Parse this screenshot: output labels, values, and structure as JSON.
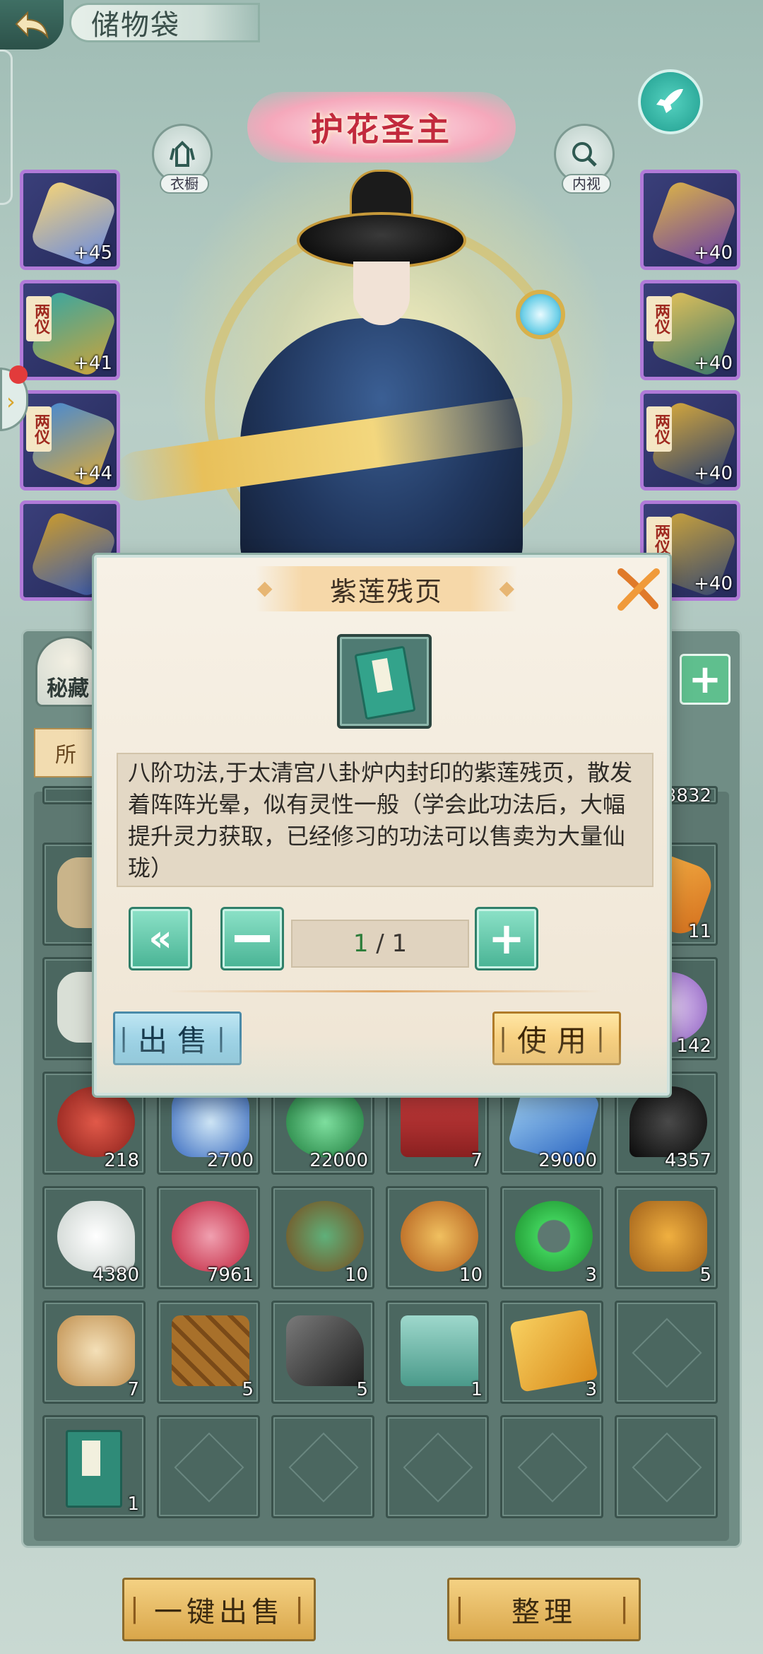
{
  "header": {
    "title": "储物袋",
    "back_icon": "back-arrow-icon"
  },
  "stage": {
    "title_banner": "护花圣主",
    "btn_outfit": "衣橱",
    "btn_inspect": "内视"
  },
  "left_slots": [
    {
      "level": "+45",
      "tag": ""
    },
    {
      "level": "+41",
      "tag": "两仪"
    },
    {
      "level": "+44",
      "tag": "两仪"
    },
    {
      "level": "",
      "tag": ""
    }
  ],
  "right_slots": [
    {
      "level": "+40",
      "tag": ""
    },
    {
      "level": "+40",
      "tag": "两仪"
    },
    {
      "level": "+40",
      "tag": "两仪"
    },
    {
      "level": "+40",
      "tag": "两仪"
    }
  ],
  "bag": {
    "tab_label": "秘藏",
    "filter_chip": "所"
  },
  "grid": {
    "partial_top": [
      "",
      "",
      "",
      "",
      "",
      "3832"
    ],
    "rows": [
      [
        "",
        "",
        "",
        "",
        "",
        "11"
      ],
      [
        "",
        "",
        "",
        "",
        "",
        "142"
      ],
      [
        "218",
        "2700",
        "22000",
        "7",
        "29000",
        "4357"
      ],
      [
        "4380",
        "7961",
        "10",
        "10",
        "3",
        "5"
      ],
      [
        "7",
        "5",
        "5",
        "1",
        "3",
        ""
      ],
      [
        "1",
        "",
        "",
        "",
        "",
        ""
      ]
    ]
  },
  "bottom_buttons": {
    "sell_all": "一键出售",
    "sort": "整理"
  },
  "dialog": {
    "title": "紫莲残页",
    "description": "八阶功法,于太清宫八卦炉内封印的紫莲残页，散发着阵阵光晕，似有灵性一般（学会此功法后，大幅提升灵力获取，已经修习的功法可以售卖为大量仙珑）",
    "qty_current": "1",
    "qty_total": " / 1",
    "sell": "出售",
    "use": "使用"
  }
}
